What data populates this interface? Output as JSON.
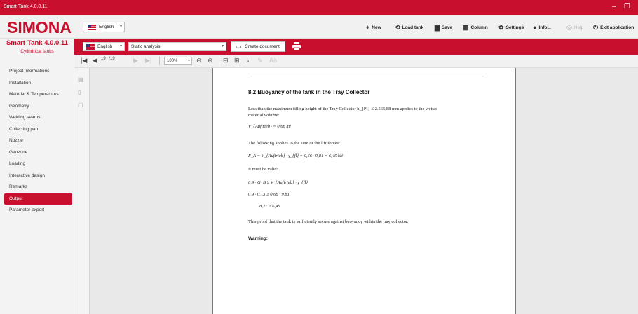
{
  "window": {
    "title": "Smart-Tank 4.0.0.11",
    "minimize": "–",
    "restore": "❐"
  },
  "brand": {
    "logo": "SIMONA"
  },
  "header": {
    "language": "English",
    "buttons": [
      {
        "label": "New",
        "icon": "+"
      },
      {
        "label": "Load tank",
        "icon": "⟲"
      },
      {
        "label": "Save",
        "icon": "▆"
      },
      {
        "label": "Column",
        "icon": "▦"
      },
      {
        "label": "Settings",
        "icon": "✿"
      },
      {
        "label": "Info...",
        "icon": "●"
      },
      {
        "label": "Help",
        "icon": "◎"
      },
      {
        "label": "Exit application",
        "icon": "⏻"
      }
    ]
  },
  "sidebar": {
    "app_name": "Smart-Tank 4.0.0.11",
    "subtitle": "Cylindrical tanks",
    "items": [
      {
        "label": "Project informations"
      },
      {
        "label": "Installation"
      },
      {
        "label": "Material & Temperatures"
      },
      {
        "label": "Geometry"
      },
      {
        "label": "Welding seams"
      },
      {
        "label": "Collecting pan"
      },
      {
        "label": "Nozzle"
      },
      {
        "label": "Geozone"
      },
      {
        "label": "Loading"
      },
      {
        "label": "Interactive design"
      },
      {
        "label": "Remarks"
      },
      {
        "label": "Output"
      },
      {
        "label": "Parameter export"
      }
    ],
    "active_index": 11
  },
  "report_bar": {
    "language": "English",
    "analysis": "Static analysis",
    "create_document": "Create document"
  },
  "viewer": {
    "page_current": "19",
    "page_total": "/19",
    "zoom": "100%"
  },
  "document": {
    "heading": "8.2 Buoyancy of the tank in the Tray Collector",
    "lines": [
      "Less than the maximum filling height of the Tray Collector h_{PI} ≤ 2.565,88 mm applies to the wetted",
      "material volume:",
      "V_{Auftrieb} = 0,66 m³",
      "The following applies to the sum of the lift forces:",
      "F_A = V_{Auftrieb} · γ_{fl} = 0,66 · 9,81 = 6,45 kN",
      "It must be valid:",
      "0,9 · G_B ≥ V_{Auftrieb} · γ_{fl}",
      "0,9 · 0,13 ≥ 0,66 · 9,81",
      "8,21 ≥ 6,45",
      "This proof that the tank is sufficiently secure against buoyancy within the tray collector."
    ],
    "warning": "Warning:"
  },
  "colors": {
    "brand_red": "#c8102e"
  }
}
